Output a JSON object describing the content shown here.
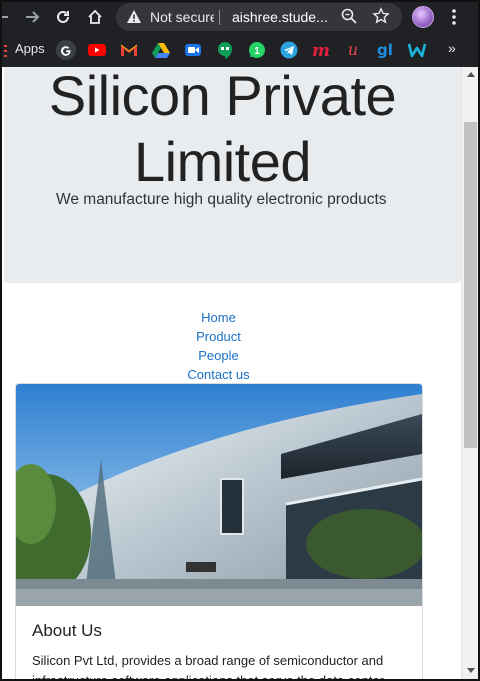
{
  "browser": {
    "omnibox": {
      "security_text": "Not secure",
      "url": "aishree.stude..."
    },
    "bookmarks": {
      "apps_label": "Apps",
      "items": [
        {
          "icon": "google-icon",
          "color": "#4285f4"
        },
        {
          "icon": "youtube-icon",
          "color": "#ff0000"
        },
        {
          "icon": "gmail-icon",
          "color": "#ea4335"
        },
        {
          "icon": "google-drive-icon",
          "color": "#0f9d58"
        },
        {
          "icon": "google-meet-icon",
          "color": "#00897b"
        },
        {
          "icon": "hangouts-icon",
          "color": "#0f9d58"
        },
        {
          "icon": "whatsapp-icon",
          "color": "#25d366"
        },
        {
          "icon": "telegram-icon",
          "color": "#2aa3df"
        },
        {
          "icon": "m-icon",
          "color": "#e21f3c"
        },
        {
          "icon": "u-icon",
          "color": "#e8444e"
        },
        {
          "icon": "gl-icon",
          "color": "#1e8fe0"
        },
        {
          "icon": "w-icon",
          "color": "#18b5d9"
        }
      ],
      "more_label": "»"
    }
  },
  "header": {
    "title_line1": "Silicon Private",
    "title_line2": "Limited",
    "lead": "We manufacture high quality electronic products"
  },
  "nav": {
    "items": [
      "Home",
      "Product",
      "People",
      "Contact us"
    ]
  },
  "about": {
    "title": "About Us",
    "text": "Silicon Pvt Ltd, provides a broad range of semiconductor and infrastructure software applications that serve the data center"
  },
  "colors": {
    "jumbotron_bg": "#e9ecef",
    "link": "#1a6fc4",
    "chrome_bg": "#202124"
  }
}
